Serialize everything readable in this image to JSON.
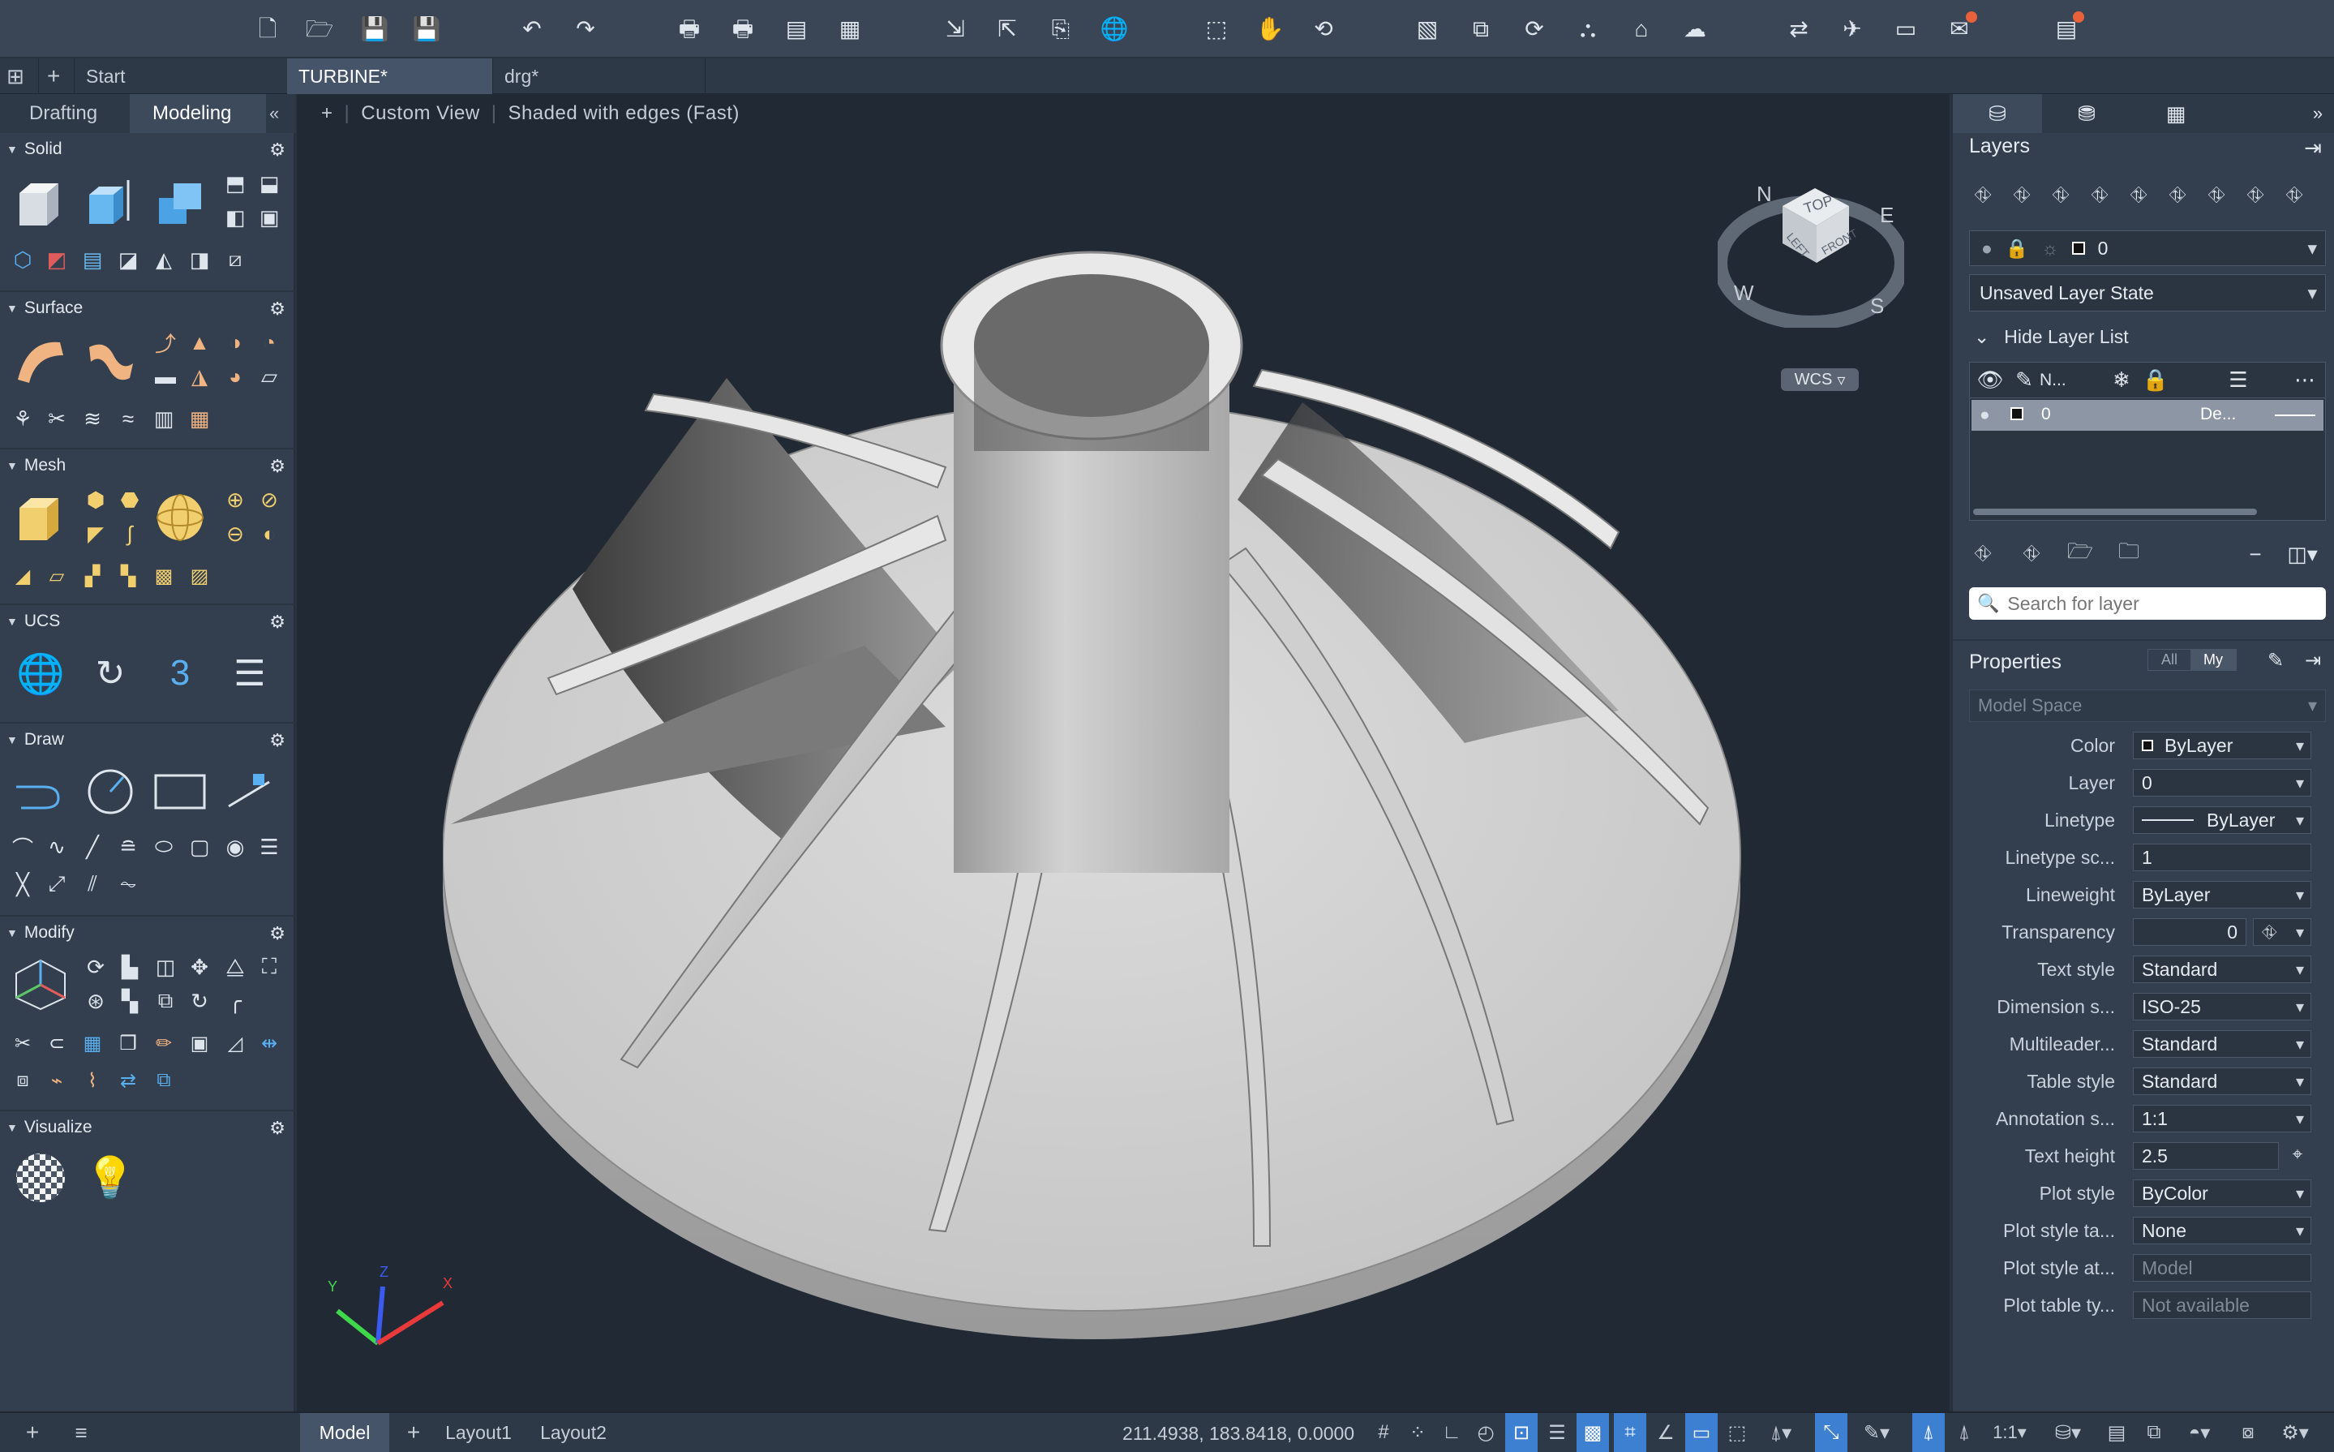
{
  "toolbar": {
    "icons": [
      "new-icon",
      "open-icon",
      "save-icon",
      "save-as-icon",
      "undo-icon",
      "redo-icon",
      "plot-icon",
      "batch-plot-icon",
      "publish-icon",
      "page-setup-icon",
      "import-icon",
      "export-icon",
      "attach-icon",
      "web-icon",
      "zoom-window-icon",
      "pan-icon",
      "orbit-icon",
      "match-icon",
      "copy-clip-icon",
      "xref-icon",
      "layer-tool-icon",
      "attribute-icon",
      "cloud-icon",
      "share-icon",
      "send-icon",
      "screen-icon",
      "notification-icon",
      "markup-icon"
    ]
  },
  "file_tabs": {
    "start": "Start",
    "tab1": "TURBINE*",
    "tab2": "drg*"
  },
  "left_panel": {
    "tabs": [
      "Drafting",
      "Modeling"
    ],
    "collapse": "«",
    "sections": [
      {
        "title": "Solid"
      },
      {
        "title": "Surface"
      },
      {
        "title": "Mesh"
      },
      {
        "title": "UCS"
      },
      {
        "title": "Draw"
      },
      {
        "title": "Modify"
      },
      {
        "title": "Visualize"
      }
    ]
  },
  "viewport": {
    "plus": "+",
    "view": "Custom View",
    "style": "Shaded with edges (Fast)",
    "viewcube": {
      "top": "TOP",
      "left": "LEFT",
      "front": "FRONT",
      "n": "N",
      "e": "E",
      "s": "S",
      "w": "W"
    },
    "wcs": "WCS",
    "ucs": {
      "x": "X",
      "y": "Y",
      "z": "Z"
    }
  },
  "layers": {
    "title": "Layers",
    "current": "0",
    "state": "Unsaved Layer State",
    "hide_list": "Hide Layer List",
    "columns": {
      "name": "N..."
    },
    "rows": [
      {
        "name": "0",
        "linetype": "De..."
      }
    ],
    "search_placeholder": "Search for layer"
  },
  "properties": {
    "title": "Properties",
    "all": "All",
    "my": "My",
    "space": "Model Space",
    "rows": [
      {
        "label": "Color",
        "value": "ByLayer"
      },
      {
        "label": "Layer",
        "value": "0"
      },
      {
        "label": "Linetype",
        "value": "ByLayer"
      },
      {
        "label": "Linetype sc...",
        "value": "1"
      },
      {
        "label": "Lineweight",
        "value": "ByLayer"
      },
      {
        "label": "Transparency",
        "value": "0"
      },
      {
        "label": "Text style",
        "value": "Standard"
      },
      {
        "label": "Dimension s...",
        "value": "ISO-25"
      },
      {
        "label": "Multileader...",
        "value": "Standard"
      },
      {
        "label": "Table style",
        "value": "Standard"
      },
      {
        "label": "Annotation s...",
        "value": "1:1"
      },
      {
        "label": "Text height",
        "value": "2.5"
      },
      {
        "label": "Plot style",
        "value": "ByColor"
      },
      {
        "label": "Plot style ta...",
        "value": "None"
      },
      {
        "label": "Plot style at...",
        "value": "Model"
      },
      {
        "label": "Plot table ty...",
        "value": "Not available"
      }
    ]
  },
  "statusbar": {
    "tabs": [
      "Model",
      "Layout1",
      "Layout2"
    ],
    "plus": "+",
    "coords": "211.4938, 183.8418, 0.0000",
    "scale": "1:1"
  }
}
